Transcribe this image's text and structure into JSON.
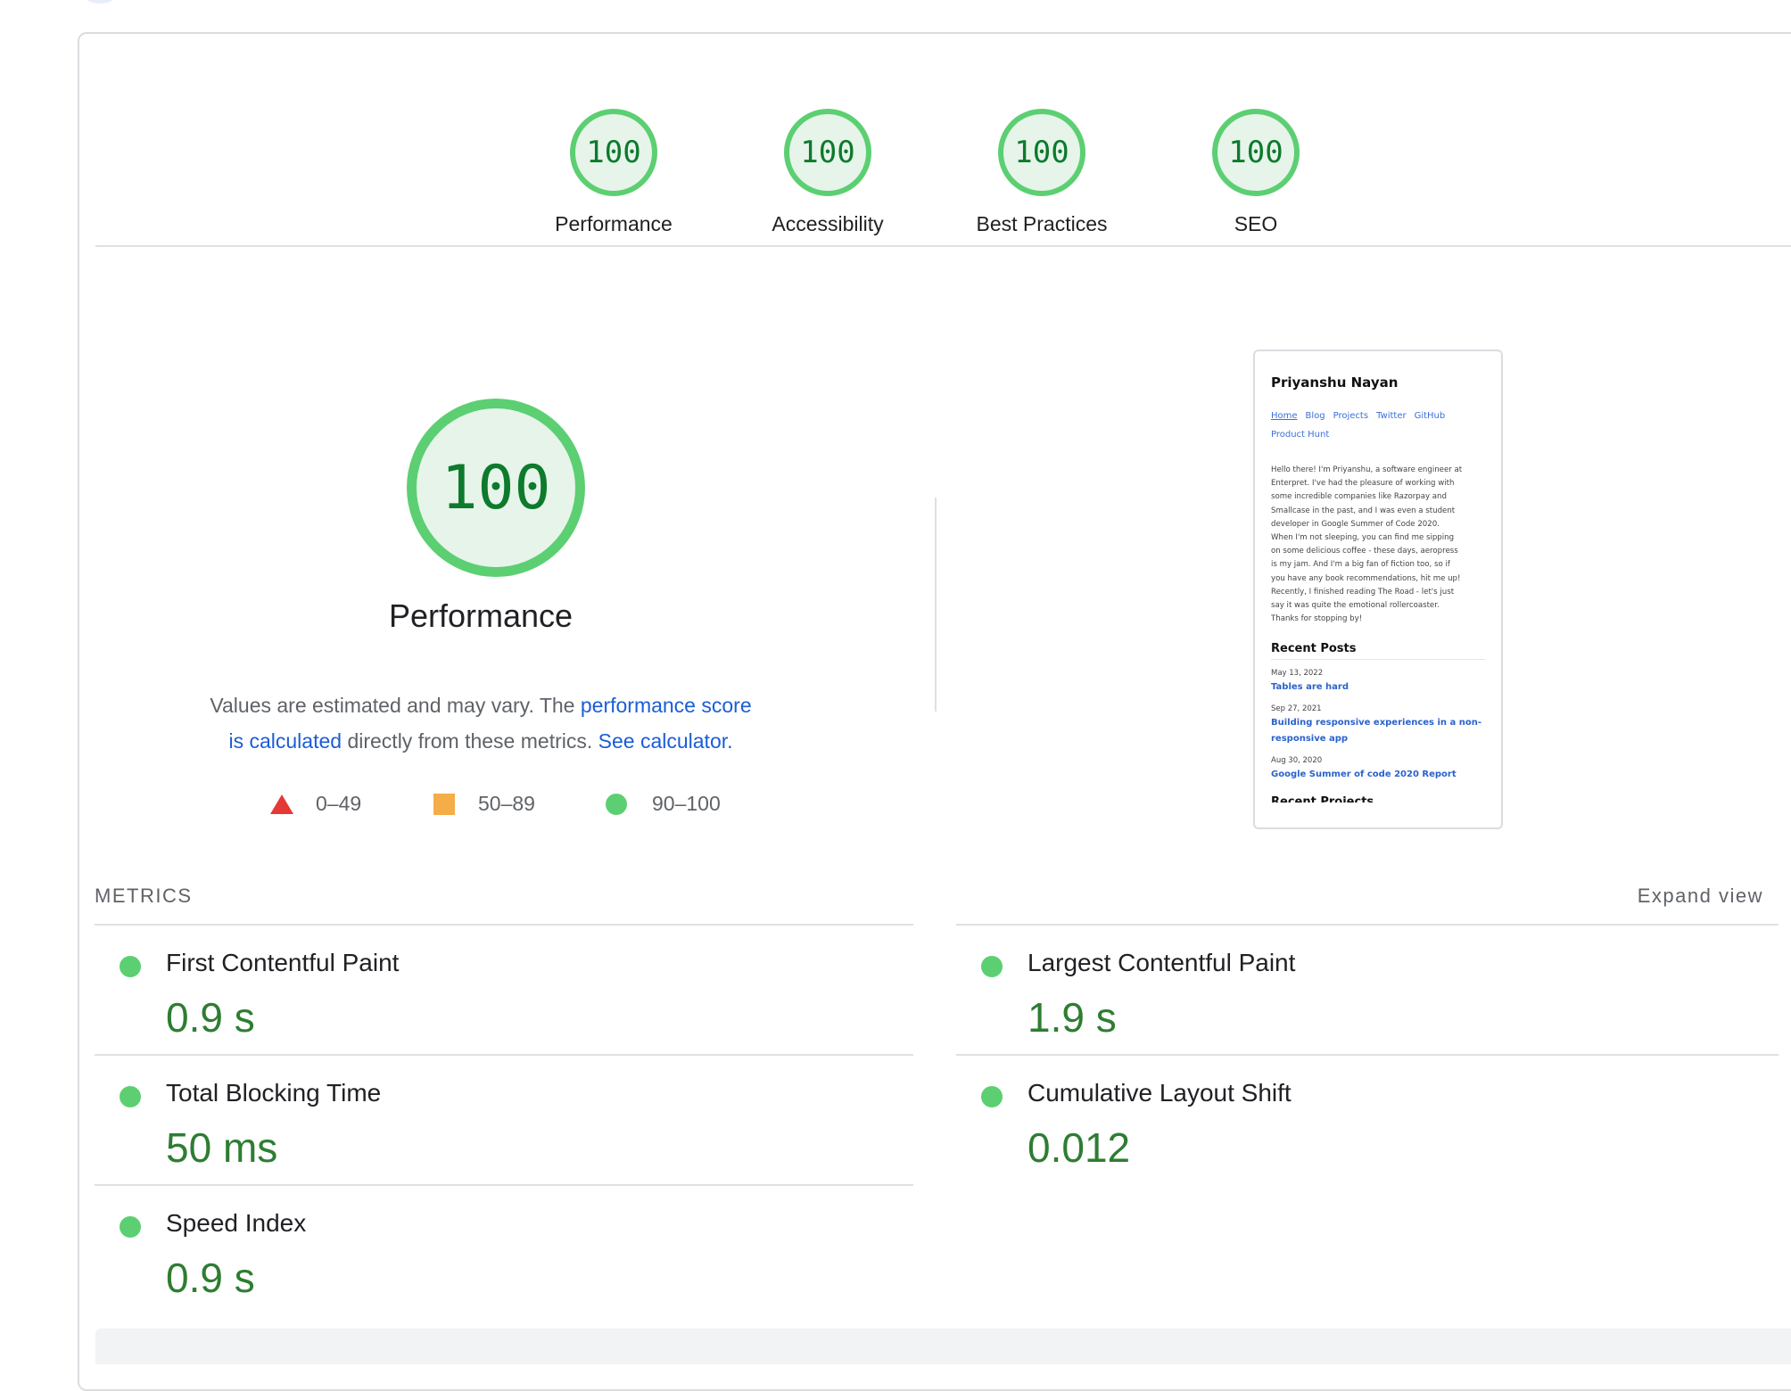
{
  "gauges": [
    {
      "score": "100",
      "label": "Performance"
    },
    {
      "score": "100",
      "label": "Accessibility"
    },
    {
      "score": "100",
      "label": "Best Practices"
    },
    {
      "score": "100",
      "label": "SEO"
    }
  ],
  "performance": {
    "score": "100",
    "title": "Performance",
    "desc_part1": "Values are estimated and may vary. The ",
    "desc_link1": "performance score is calculated",
    "desc_part2": " directly from these metrics. ",
    "desc_link2": "See calculator."
  },
  "legend": {
    "fail": "0–49",
    "average": "50–89",
    "pass": "90–100"
  },
  "screenshot": {
    "name": "Priyanshu Nayan",
    "nav": [
      "Home",
      "Blog",
      "Projects",
      "Twitter",
      "GitHub",
      "Product Hunt"
    ],
    "bio_lines": [
      "Hello there! I'm Priyanshu, a software engineer at",
      "Enterpret. I've had the pleasure of working with",
      "some incredible companies like Razorpay and",
      "Smallcase in the past, and I was even a student",
      "developer in Google Summer of Code 2020.",
      "When I'm not sleeping, you can find me sipping",
      "on some delicious coffee - these days, aeropress",
      "is my jam. And I'm a big fan of fiction too, so if",
      "you have any book recommendations, hit me up!",
      "Recently, I finished reading The Road - let's just",
      "say it was quite the emotional rollercoaster.",
      "Thanks for stopping by!"
    ],
    "recent_title": "Recent Posts",
    "posts": [
      {
        "date": "May 13, 2022",
        "title": "Tables are hard"
      },
      {
        "date": "Sep 27, 2021",
        "title": "Building responsive experiences in a non-responsive app"
      },
      {
        "date": "Aug 30, 2020",
        "title": "Google Summer of code 2020 Report"
      }
    ],
    "cut_title": "Recent Projects"
  },
  "metrics": {
    "heading": "METRICS",
    "expand_label": "Expand view",
    "items": [
      {
        "label": "First Contentful Paint",
        "value": "0.9 s"
      },
      {
        "label": "Largest Contentful Paint",
        "value": "1.9 s"
      },
      {
        "label": "Total Blocking Time",
        "value": "50 ms"
      },
      {
        "label": "Cumulative Layout Shift",
        "value": "0.012"
      },
      {
        "label": "Speed Index",
        "value": "0.9 s"
      }
    ]
  },
  "colors": {
    "pass": "#5ccf72",
    "average": "#f4ad47",
    "fail": "#e53935",
    "pass_text": "#2e7d32",
    "link": "#1a5dd8"
  }
}
